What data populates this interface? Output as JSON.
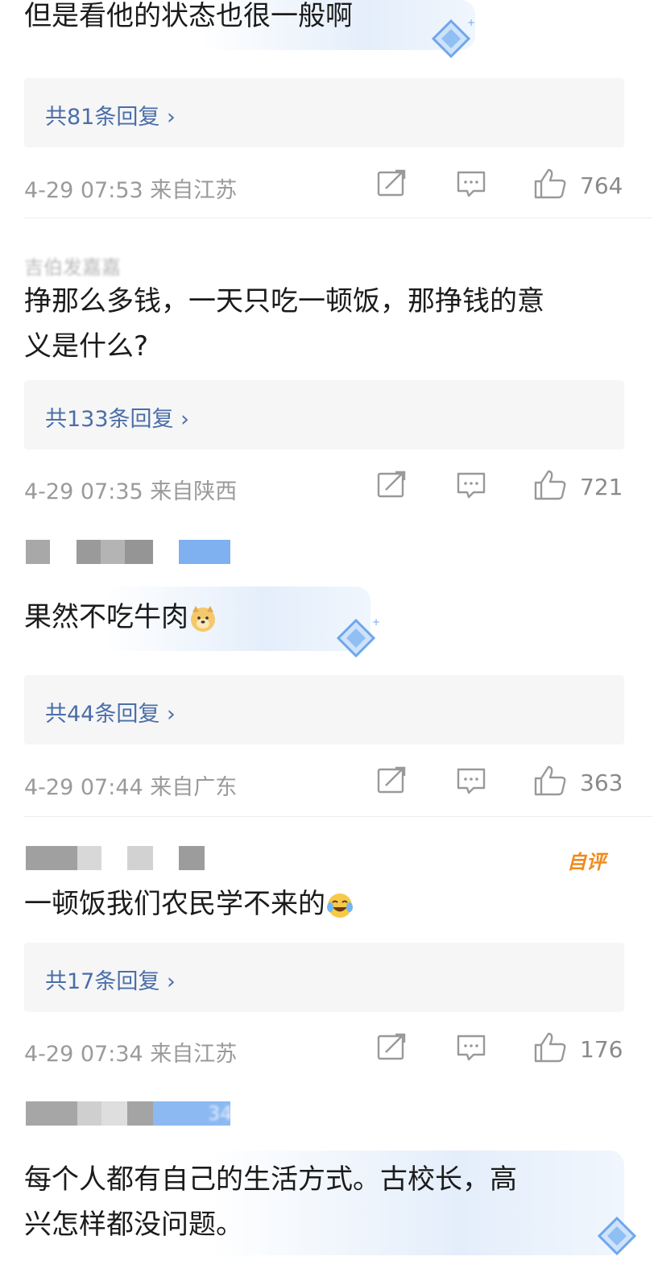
{
  "comments": [
    {
      "text": "但是看他的状态也很一般啊",
      "reply_label": "共81条回复 ›",
      "time_location": "4-29 07:53 来自江苏",
      "likes": "764"
    },
    {
      "username": "吉伯发嘉嘉",
      "text_line1": "挣那么多钱，一天只吃一顿饭，那挣钱的意",
      "text_line2": "义是什么?",
      "reply_label": "共133条回复 ›",
      "time_location": "4-29 07:35 来自陕西",
      "likes": "721"
    },
    {
      "text": "果然不吃牛肉",
      "emoji": "doge-emoji",
      "reply_label": "共44条回复 ›",
      "time_location": "4-29 07:44 来自广东",
      "likes": "363"
    },
    {
      "badge": "自评",
      "text": "一顿饭我们农民学不来的",
      "emoji": "laugh-cry-emoji",
      "reply_label": "共17条回复 ›",
      "time_location": "4-29 07:34 来自江苏",
      "likes": "176"
    },
    {
      "username_suffix": "34",
      "text_line1": "每个人都有自己的生活方式。古校长，高",
      "text_line2": "兴怎样都没问题。"
    }
  ],
  "colors": {
    "reply_link": "#4b6ea8",
    "meta_gray": "#9a9a9a",
    "badge_orange": "#f08a1c",
    "reply_bg": "#f6f6f7"
  },
  "icons": [
    "share-icon",
    "comment-icon",
    "like-icon",
    "diamond-decoration-icon"
  ]
}
